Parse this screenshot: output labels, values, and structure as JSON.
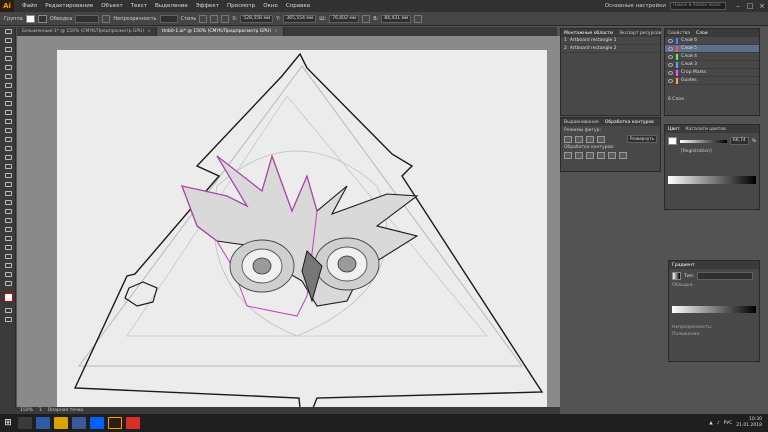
{
  "app": {
    "logo": "Ai"
  },
  "menu": [
    "Файл",
    "Редактирование",
    "Объект",
    "Текст",
    "Выделение",
    "Эффект",
    "Просмотр",
    "Окно",
    "Справка"
  ],
  "workspace": "Основные настройки",
  "search_placeholder": "Поиск в Adobe Stock",
  "controlbar": {
    "group_label": "Группа",
    "stroke_label": "Обводка",
    "opacity_label": "Непрозрачность",
    "style_label": "Стиль",
    "x": "528,558 мм",
    "y": "365,554 мм",
    "w": "76,602 мм",
    "h": "84,431 мм"
  },
  "tabs": [
    {
      "label": "Безымянный-1* @ 150% (CMYK/Предпросмотр GPU)",
      "active": false
    },
    {
      "label": "tmb0-1.ai* @ 150% (CMYK/Предпросмотр GPU)",
      "active": true
    }
  ],
  "status": {
    "zoom": "150%",
    "page": "1",
    "tool": "Опорная точка"
  },
  "artboards_panel": {
    "tabs": [
      "Монтажные области",
      "Экспорт ресурсов"
    ],
    "items": [
      {
        "num": "1",
        "name": "Artboard rectangle 1"
      },
      {
        "num": "2",
        "name": "Artboard rectangle 2"
      }
    ]
  },
  "pathfinder_panel": {
    "tabs": [
      "Выравнивание",
      "Обработка контуров"
    ],
    "shape_modes": "Режимы фигур:",
    "pathfinders": "Обработка контуров:",
    "expand": "Развернуть"
  },
  "layers_panel": {
    "tabs": [
      "Свойства",
      "Слои"
    ],
    "layers": [
      {
        "name": "Слой 6",
        "color": "#4f7fff",
        "selected": false
      },
      {
        "name": "Слой 5",
        "color": "#ff4f4f",
        "selected": true
      },
      {
        "name": "Слой 4",
        "color": "#4fff4f",
        "selected": false
      },
      {
        "name": "Слой 3",
        "color": "#4fa6ff",
        "selected": false
      },
      {
        "name": "Crop Marks",
        "color": "#ff4fff",
        "selected": false
      },
      {
        "name": "Guides",
        "color": "#ffa64f",
        "selected": false
      }
    ],
    "footer": "6 Слоя"
  },
  "color_panel": {
    "tabs": [
      "Цвет",
      "Каталоги цветов"
    ],
    "tint_value": "66,74",
    "unit": "%",
    "registration": "[Registration]"
  },
  "gradient_panel": {
    "title": "Градиент",
    "type_label": "Тип:",
    "stroke_label": "Обводка:",
    "opacity_label": "Непрозрачность:",
    "position_label": "Положение:"
  },
  "taskbar": {
    "lang": "РУС",
    "time": "10:30",
    "date": "21.01.2018"
  },
  "colors": {
    "layer_selected": "#5d6f8a",
    "accent": "#ff9a00",
    "magenta_path": "#c040c0"
  }
}
